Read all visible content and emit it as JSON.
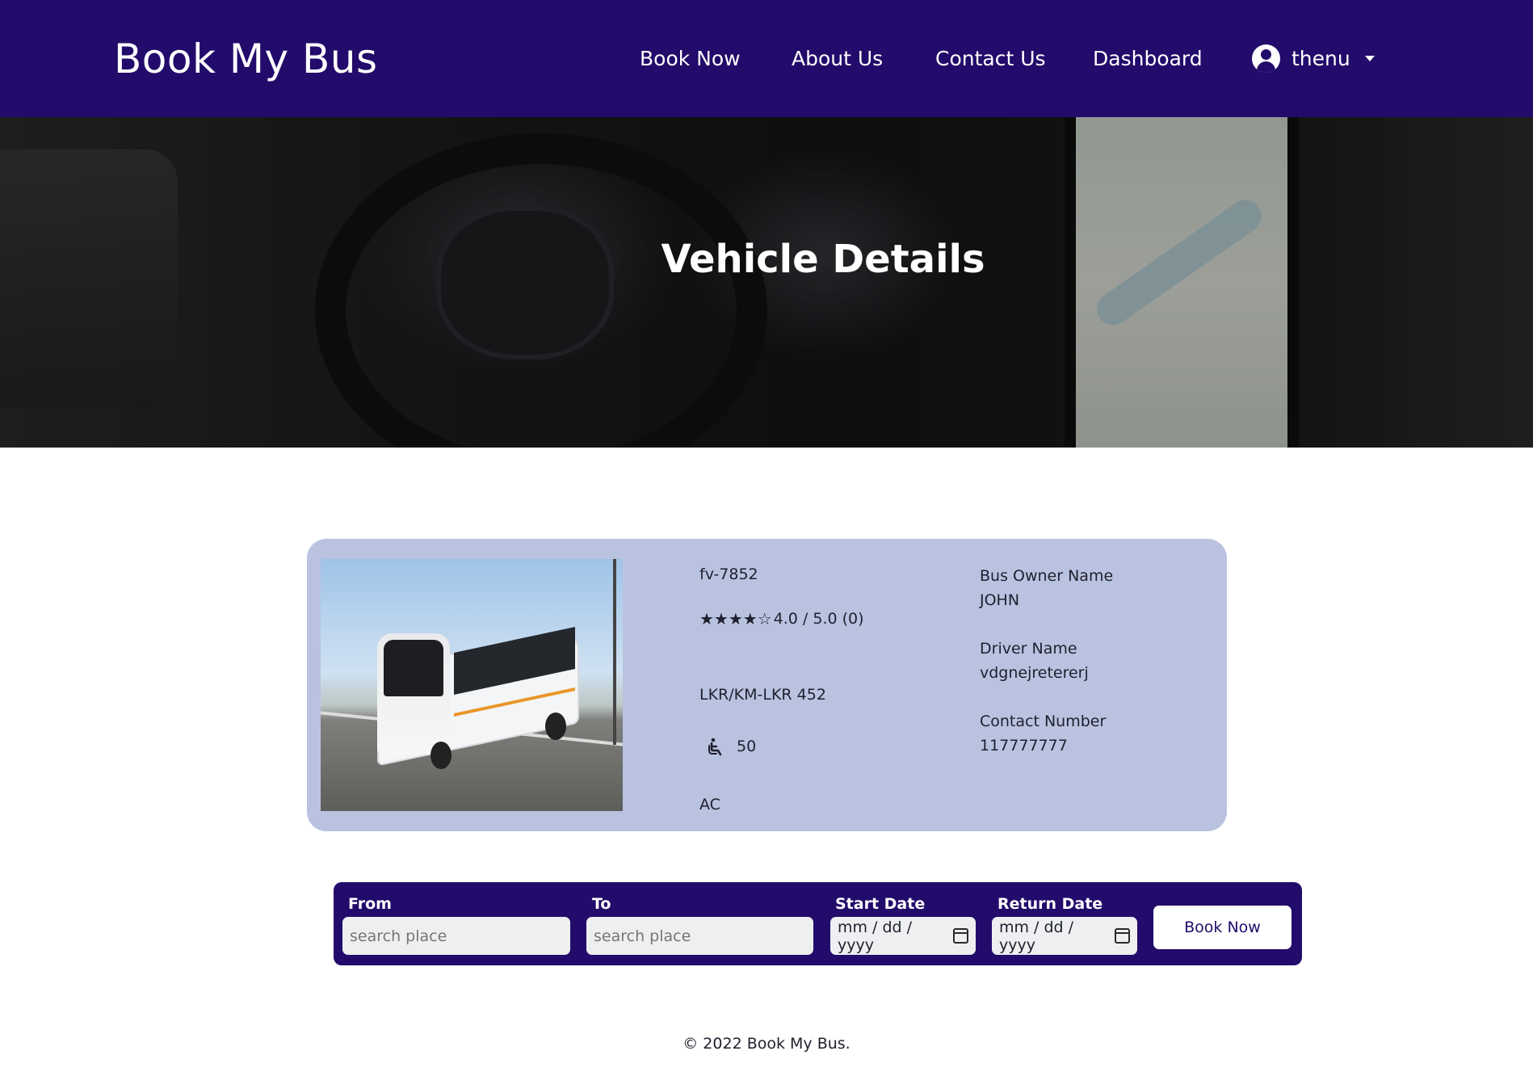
{
  "navbar": {
    "brand": "Book My Bus",
    "links": [
      "Book Now",
      "About Us",
      "Contact Us",
      "Dashboard"
    ],
    "user": "thenu"
  },
  "hero": {
    "title": "Vehicle Details"
  },
  "vehicle": {
    "registration": "fv-7852",
    "stars": "★★★★☆",
    "rating_value": 4,
    "rating_text": "4.0 / 5.0 (0)",
    "fare": "LKR/KM-LKR 452",
    "seats": "50",
    "type": "AC",
    "owner_label": "Bus Owner Name",
    "owner_value": "JOHN",
    "driver_label": "Driver Name",
    "driver_value": "vdgnejretererj",
    "contact_label": "Contact Number",
    "contact_value": "117777777"
  },
  "booking": {
    "from_label": "From",
    "from_placeholder": "search place",
    "to_label": "To",
    "to_placeholder": "search place",
    "start_label": "Start Date",
    "start_value": "mm / dd / yyyy",
    "return_label": "Return Date",
    "return_value": "mm / dd / yyyy",
    "button": "Book Now"
  },
  "footer": {
    "text": "© 2022 Book My Bus."
  },
  "colors": {
    "primary": "#230b6b",
    "card": "#b9c3e0",
    "input": "#eeeff1"
  }
}
